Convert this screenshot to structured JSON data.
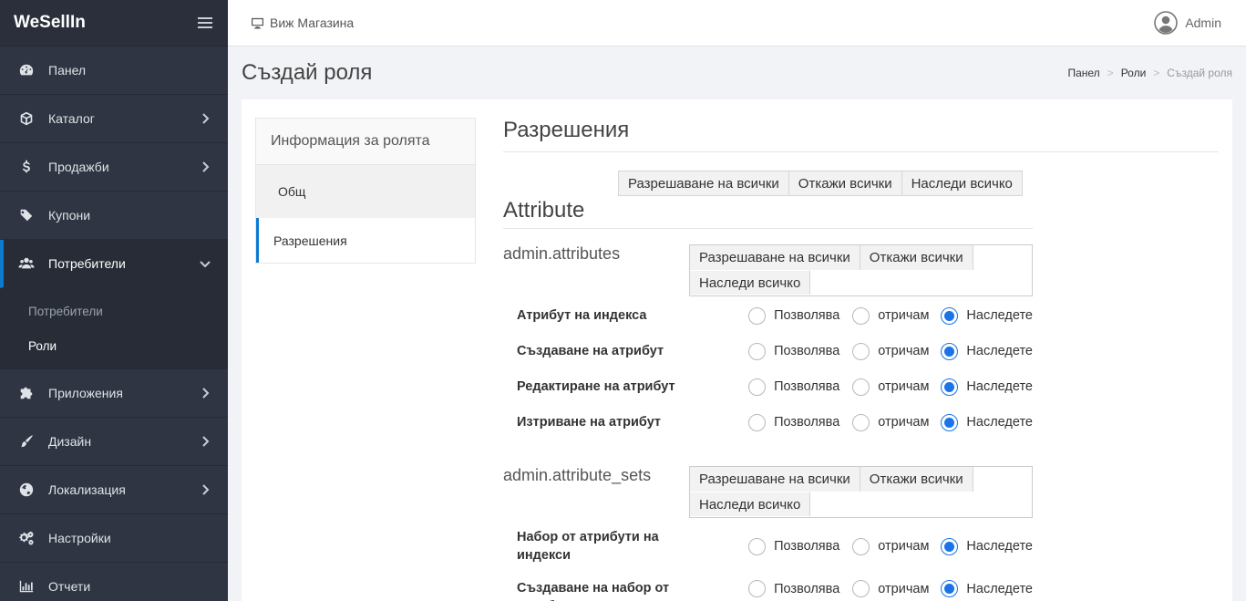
{
  "brand": "WeSellIn",
  "sidebar": {
    "items": [
      {
        "label": "Панел",
        "icon": "dashboard-icon"
      },
      {
        "label": "Каталог",
        "icon": "cube-icon"
      },
      {
        "label": "Продажби",
        "icon": "dollar-icon"
      },
      {
        "label": "Купони",
        "icon": "tags-icon"
      },
      {
        "label": "Потребители",
        "icon": "users-icon"
      },
      {
        "label": "Приложения",
        "icon": "puzzle-icon"
      },
      {
        "label": "Дизайн",
        "icon": "brush-icon"
      },
      {
        "label": "Локализация",
        "icon": "globe-icon"
      },
      {
        "label": "Настройки",
        "icon": "gears-icon"
      },
      {
        "label": "Отчети",
        "icon": "bar-chart-icon"
      }
    ],
    "submenu": [
      "Потребители",
      "Роли"
    ]
  },
  "topbar": {
    "view_store": "Виж Магазина",
    "user": "Admin"
  },
  "header": {
    "title": "Създай роля",
    "breadcrumb": [
      "Панел",
      "Роли",
      "Създай роля"
    ],
    "sep": ">"
  },
  "tabs": {
    "head": "Информация за ролята",
    "items": [
      "Общ",
      "Разрешения"
    ]
  },
  "permissions": {
    "title": "Разрешения",
    "allow_all": "Разрешаване на всички",
    "deny_all": "Откажи всички",
    "inherit_all": "Наследи всичко",
    "section": "Attribute",
    "radio_allow": "Позволява",
    "radio_deny": "отричам",
    "radio_inherit": "Наследете",
    "groups": [
      {
        "name": "admin.attributes",
        "rows": [
          "Атрибут на индекса",
          "Създаване на атрибут",
          "Редактиране на атрибут",
          "Изтриване на атрибут"
        ]
      },
      {
        "name": "admin.attribute_sets",
        "rows": [
          "Набор от атрибути на индекси",
          "Създаване на набор от атрибути"
        ]
      }
    ]
  },
  "colors": {
    "sidebar": "#2f3542",
    "accent": "#0b7ad1",
    "radio": "#1a73e8"
  }
}
